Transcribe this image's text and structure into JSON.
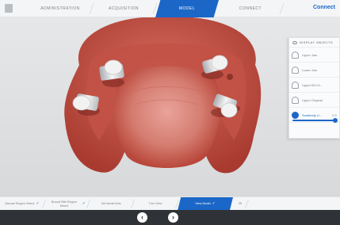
{
  "topnav": {
    "steps": [
      "ADMINISTRATION",
      "ACQUISITION",
      "MODEL",
      "CONNECT"
    ],
    "active_index": 2,
    "connect_link": "Connect"
  },
  "panel": {
    "title": "DISPLAY OBJECTS",
    "rows": [
      {
        "label": "Upper Jaw",
        "value": "",
        "icon": "upper-jaw-icon"
      },
      {
        "label": "Lower Jaw",
        "value": "",
        "icon": "lower-jaw-icon"
      },
      {
        "label": "Upper Bit.Ch...",
        "value": "",
        "icon": "bite-icon"
      },
      {
        "label": "Upper Original",
        "value": "",
        "icon": "tooth-icon"
      },
      {
        "label": "Scanbody U...",
        "value": "100",
        "icon": "scanbody-icon",
        "active": true
      }
    ],
    "slider_value": 0.95
  },
  "workflow": {
    "steps": [
      {
        "label": "Manual Region Select",
        "checked": true
      },
      {
        "label": "Buccal Bite Region Select",
        "checked": true
      },
      {
        "label": "Set Model Axis",
        "checked": false
      },
      {
        "label": "Trim View",
        "checked": false
      },
      {
        "label": "View Model",
        "checked": true,
        "active": true
      },
      {
        "label": "35",
        "checked": false
      }
    ]
  },
  "footer": {
    "prev_icon": "arrow-left-icon",
    "next_icon": "arrow-right-icon"
  },
  "colors": {
    "accent": "#1b67c8",
    "footer_bg": "#2f3338",
    "gum": "#c9584a"
  }
}
